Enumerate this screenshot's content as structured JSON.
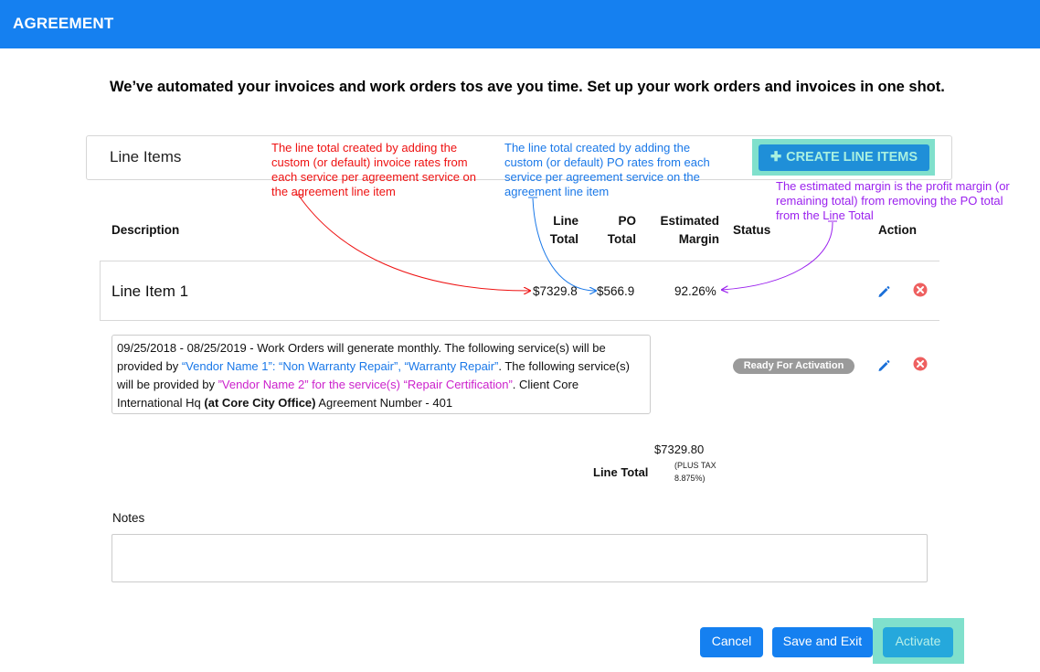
{
  "header": {
    "title": "AGREEMENT"
  },
  "intro": {
    "text": "We’ve automated your invoices and work orders tos ave you time. Set up your work orders and invoices in one shot."
  },
  "line_items": {
    "title": "Line Items",
    "create_button": "CREATE LINE ITEMS",
    "create_icon": "plus-icon"
  },
  "annotations": {
    "line_total": "The line total created by adding the custom (or default) invoice rates from each service per agreement service on the agreement line item",
    "po_total": "The line total created by adding the custom (or default) PO rates from each service per agreement service on the agreement line item",
    "margin": "The estimated margin is the profit margin (or remaining total) from removing the PO total from the Line Total",
    "colors": {
      "line_total": "#ee1111",
      "po_total": "#1a78e8",
      "margin": "#9b22ee"
    }
  },
  "table": {
    "headers": {
      "description": "Description",
      "line_total": "Line Total",
      "po_total": "PO Total",
      "margin": "Estimated Margin",
      "status": "Status",
      "action": "Action"
    },
    "row": {
      "name": "Line Item 1",
      "line_total": "$7329.8",
      "po_total": "$566.9",
      "margin": "92.26%"
    },
    "detail": {
      "text_1": "09/25/2018 - 08/25/2019 - Work Orders will generate monthly. The following service(s) will be provided by ",
      "vendor_1": "“Vendor Name 1”: “Non Warranty Repair”, “Warranty Repair”",
      "text_2": ". The following service(s) will be provided by ",
      "vendor_2": "”Vendor Name 2” for the service(s) “Repair Certification”",
      "text_3": ". Client Core International Hq ",
      "office": "(at Core City Office)",
      "text_4": " Agreement Number - 401",
      "status": "Ready For Activation"
    },
    "icons": {
      "edit": "pencil-icon",
      "remove": "remove-icon"
    }
  },
  "totals": {
    "amount": "$7329.80",
    "label": "Line Total",
    "tax_note": "(PLUS TAX 8.875%)"
  },
  "notes": {
    "label": "Notes",
    "value": ""
  },
  "footer": {
    "cancel": "Cancel",
    "save_exit": "Save and Exit",
    "activate": "Activate"
  }
}
